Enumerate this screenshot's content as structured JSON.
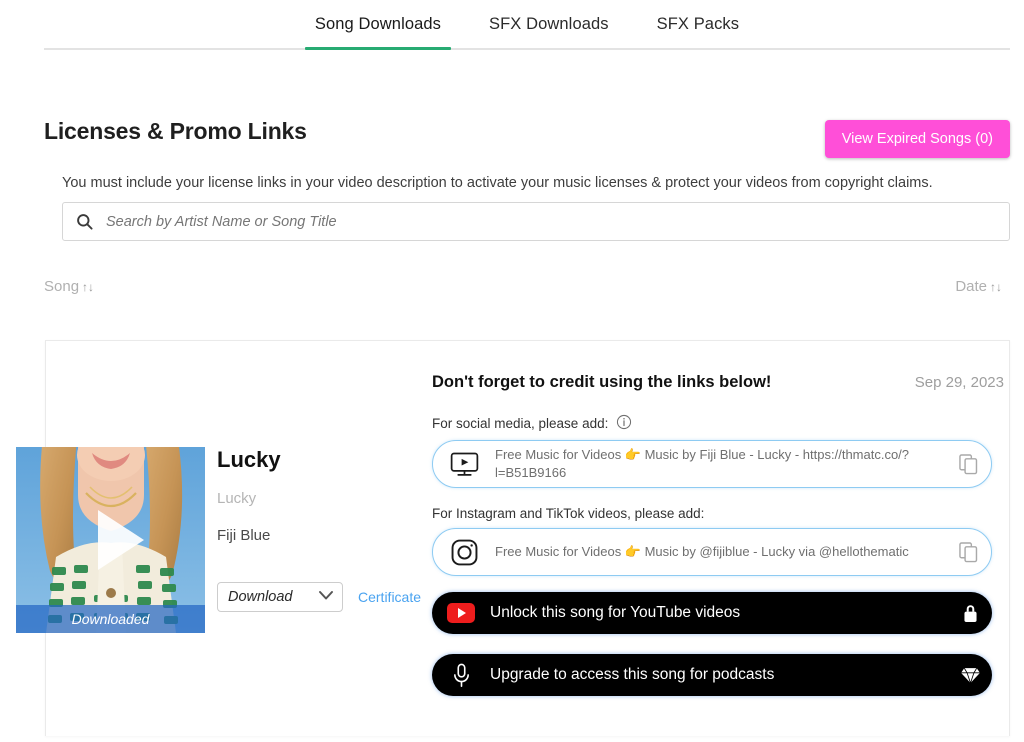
{
  "tabs": [
    {
      "label": "Song Downloads",
      "active": true
    },
    {
      "label": "SFX Downloads",
      "active": false
    },
    {
      "label": "SFX Packs",
      "active": false
    }
  ],
  "header": {
    "title": "Licenses & Promo Links",
    "expired_button": "View Expired Songs (0)",
    "subtitle": "You must include your license links in your video description to activate your music licenses & protect your videos from copyright claims."
  },
  "search": {
    "placeholder": "Search by Artist Name or Song Title",
    "value": "",
    "icon": "search-icon"
  },
  "sort": {
    "song_label": "Song",
    "date_label": "Date",
    "arrows": "↑↓"
  },
  "card": {
    "thumbnail": {
      "badge": "Downloaded",
      "play_icon": "play-icon"
    },
    "song": {
      "title": "Lucky",
      "subtitle": "Lucky",
      "artist": "Fiji Blue"
    },
    "download_select": {
      "value": "Download",
      "chevron": "chevron-down-icon"
    },
    "certificate_link": "Certificate",
    "credit_heading": "Don't forget to credit using the links below!",
    "date": "Sep 29, 2023",
    "social_label": "For social media, please add:",
    "social_info_icon": "info-icon",
    "social_link_text": "Free Music for Videos 👉 Music by Fiji Blue - Lucky - https://thmatc.co/?l=B51B9166",
    "social_link_icon": "video-monitor-icon",
    "instagram_label": "For Instagram and TikTok videos, please add:",
    "instagram_link_text": "Free Music for Videos 👉 Music by @fijiblue - Lucky via @hellothematic",
    "instagram_link_icon": "instagram-icon",
    "copy_icon": "copy-icon",
    "cta_youtube": {
      "label": "Unlock this song for YouTube videos",
      "left_icon": "youtube-icon",
      "right_icon": "lock-icon"
    },
    "cta_podcast": {
      "label": "Upgrade to access this song for podcasts",
      "left_icon": "microphone-icon",
      "right_icon": "diamond-icon"
    }
  },
  "colors": {
    "accent_green": "#27ab72",
    "pink_button": "#ff4fd8",
    "link_blue": "#4aa3f0",
    "link_border": "#8ecbf2",
    "youtube_red": "#ee1d1d",
    "downloaded_band": "#2467c4"
  }
}
